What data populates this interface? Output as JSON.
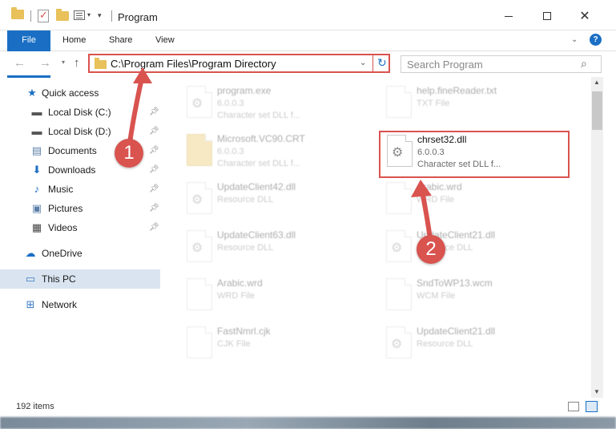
{
  "window": {
    "title": "Program",
    "controls": {
      "minimize": "minimize-icon",
      "maximize": "maximize-icon",
      "close": "✕"
    }
  },
  "ribbon": {
    "tabs": [
      "File",
      "Home",
      "Share",
      "View"
    ],
    "help": "?"
  },
  "nav": {
    "address": "C:\\Program Files\\Program Directory",
    "search_placeholder": "Search Program"
  },
  "sidebar": {
    "items": [
      {
        "label": "Quick access",
        "icon": "star-icon"
      },
      {
        "label": "Local Disk (C:)",
        "icon": "drive-icon",
        "pinned": true
      },
      {
        "label": "Local Disk (D:)",
        "icon": "drive-icon",
        "pinned": true
      },
      {
        "label": "Documents",
        "icon": "documents-icon",
        "pinned": true
      },
      {
        "label": "Downloads",
        "icon": "download-icon",
        "pinned": true
      },
      {
        "label": "Music",
        "icon": "music-icon",
        "pinned": true
      },
      {
        "label": "Pictures",
        "icon": "pictures-icon",
        "pinned": true
      },
      {
        "label": "Videos",
        "icon": "videos-icon",
        "pinned": true
      },
      {
        "label": "OneDrive",
        "icon": "cloud-icon"
      },
      {
        "label": "This PC",
        "icon": "computer-icon",
        "selected": true
      },
      {
        "label": "Network",
        "icon": "network-icon"
      }
    ]
  },
  "files": [
    {
      "name": "program.exe",
      "line2": "6.0.0.3",
      "line3": "Character set DLL f...",
      "type": "exe",
      "faded": true
    },
    {
      "name": "help.fineReader.txt",
      "line2": "TXT File",
      "line3": "",
      "type": "doc",
      "faded": true
    },
    {
      "name": "Microsoft.VC90.CRT",
      "line2": "6.0.0.3",
      "line3": "Character set DLL f...",
      "type": "folder",
      "faded": true
    },
    {
      "name": "chrset32.dll",
      "line2": "6.0.0.3",
      "line3": "Character set DLL f...",
      "type": "dll",
      "faded": false
    },
    {
      "name": "UpdateClient42.dll",
      "line2": "Resource DLL",
      "line3": "",
      "type": "dll",
      "faded": true
    },
    {
      "name": "Arabic.wrd",
      "line2": "WRD File",
      "line3": "",
      "type": "doc",
      "faded": true
    },
    {
      "name": "UpdateClient63.dll",
      "line2": "Resource DLL",
      "line3": "",
      "type": "dll",
      "faded": true
    },
    {
      "name": "UpdateClient21.dll",
      "line2": "Resource DLL",
      "line3": "",
      "type": "dll",
      "faded": true
    },
    {
      "name": "Arabic.wrd",
      "line2": "WRD File",
      "line3": "",
      "type": "doc",
      "faded": true
    },
    {
      "name": "SndToWP13.wcm",
      "line2": "WCM File",
      "line3": "",
      "type": "doc",
      "faded": true
    },
    {
      "name": "FastNmrl.cjk",
      "line2": "CJK File",
      "line3": "",
      "type": "doc",
      "faded": true
    },
    {
      "name": "UpdateClient21.dll",
      "line2": "Resource DLL",
      "line3": "",
      "type": "dll",
      "faded": true
    }
  ],
  "status": {
    "item_count": "192 items"
  },
  "annotations": {
    "marker1": "1",
    "marker2": "2"
  },
  "colors": {
    "accent": "#1a6fc4",
    "annotation_red": "#d9534f",
    "folder_yellow": "#e8c15a"
  }
}
